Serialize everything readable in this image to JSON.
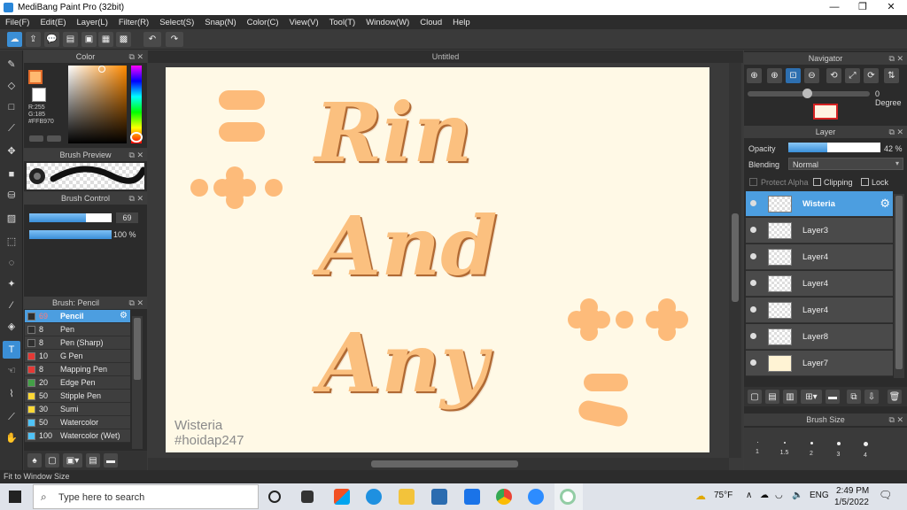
{
  "window": {
    "title": "MediBang Paint Pro (32bit)",
    "minimize": "—",
    "restore": "❐",
    "close": "✕"
  },
  "menu": [
    "File(F)",
    "Edit(E)",
    "Layer(L)",
    "Filter(R)",
    "Select(S)",
    "Snap(N)",
    "Color(C)",
    "View(V)",
    "Tool(T)",
    "Window(W)",
    "Cloud",
    "Help"
  ],
  "color_panel": {
    "title": "Color",
    "r": "R:255",
    "g": "G:185",
    "hex": "#FFB970",
    "accent": "#FFB970"
  },
  "brush_preview": {
    "title": "Brush Preview"
  },
  "brush_control": {
    "title": "Brush Control",
    "size_value": 69,
    "size_percent": "69",
    "opacity_value": 100,
    "opacity_percent": "100 %"
  },
  "brush_list": {
    "title": "Brush: Pencil",
    "items": [
      {
        "size": "69",
        "name": "Pencil",
        "color": "#2f2f2f",
        "selected": true
      },
      {
        "size": "8",
        "name": "Pen",
        "color": "#2f2f2f"
      },
      {
        "size": "8",
        "name": "Pen (Sharp)",
        "color": "#2f2f2f"
      },
      {
        "size": "10",
        "name": "G Pen",
        "color": "#e53935"
      },
      {
        "size": "8",
        "name": "Mapping Pen",
        "color": "#e53935"
      },
      {
        "size": "20",
        "name": "Edge Pen",
        "color": "#43a047"
      },
      {
        "size": "50",
        "name": "Stipple Pen",
        "color": "#fdd835"
      },
      {
        "size": "30",
        "name": "Sumi",
        "color": "#fdd835"
      },
      {
        "size": "50",
        "name": "Watercolor",
        "color": "#4fc3f7"
      },
      {
        "size": "100",
        "name": "Watercolor (Wet)",
        "color": "#4fc3f7"
      }
    ]
  },
  "document": {
    "tab": "Untitled",
    "lines": [
      "Rin",
      "And",
      "Any"
    ],
    "watermark": [
      "Wisteria",
      "#hoidap247"
    ],
    "bg": "#FFF9E6",
    "letter_color": "#FBC07F",
    "shape_color": "#FDBB7A"
  },
  "navigator": {
    "title": "Navigator",
    "rotation": "0 Degree"
  },
  "layer_panel": {
    "title": "Layer",
    "opacity_label": "Opacity",
    "opacity_value": 42,
    "opacity_text": "42 %",
    "blending_label": "Blending",
    "blending_value": "Normal",
    "protect_alpha": "Protect Alpha",
    "clipping": "Clipping",
    "lock": "Lock",
    "layers": [
      {
        "name": "Wisteria",
        "selected": true
      },
      {
        "name": "Layer3"
      },
      {
        "name": "Layer4"
      },
      {
        "name": "Layer4"
      },
      {
        "name": "Layer4"
      },
      {
        "name": "Layer8"
      },
      {
        "name": "Layer7"
      }
    ]
  },
  "brush_size": {
    "title": "Brush Size",
    "sizes": [
      "1",
      "1.5",
      "2",
      "3",
      "4"
    ]
  },
  "status": "Fit to Window Size",
  "taskbar": {
    "search_placeholder": "Type here to search",
    "temp": "75°F",
    "lang": "ENG",
    "time": "2:49 PM",
    "date": "1/5/2022"
  }
}
